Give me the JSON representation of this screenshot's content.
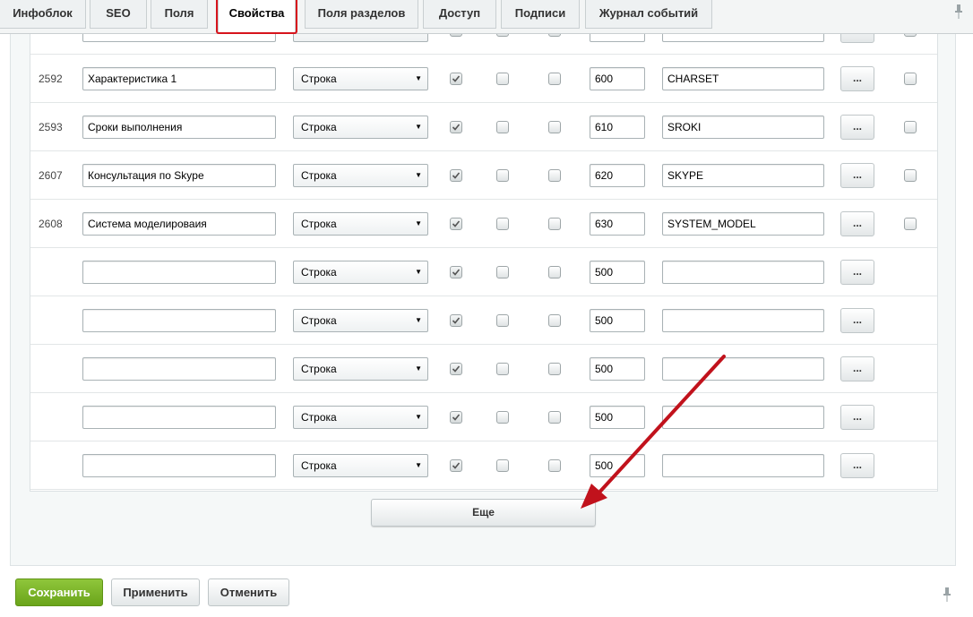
{
  "tabs": [
    {
      "label": "Инфоблок"
    },
    {
      "label": "SEO"
    },
    {
      "label": "Поля"
    },
    {
      "label": "Свойства"
    },
    {
      "label": "Поля разделов"
    },
    {
      "label": "Доступ"
    },
    {
      "label": "Подписи"
    },
    {
      "label": "Журнал событий"
    }
  ],
  "active_tab": "Свойства",
  "rows": [
    {
      "id": "",
      "name": "",
      "type": "",
      "sort": "",
      "code": "",
      "checks": [
        true,
        false,
        false
      ],
      "last_check": true
    },
    {
      "id": "2592",
      "name": "Характеристика 1",
      "type": "Строка",
      "sort": "600",
      "code": "CHARSET",
      "checks": [
        true,
        false,
        false
      ],
      "last_check": true
    },
    {
      "id": "2593",
      "name": "Сроки выполнения",
      "type": "Строка",
      "sort": "610",
      "code": "SROKI",
      "checks": [
        true,
        false,
        false
      ],
      "last_check": true
    },
    {
      "id": "2607",
      "name": "Консультация по Skype",
      "type": "Строка",
      "sort": "620",
      "code": "SKYPE",
      "checks": [
        true,
        false,
        false
      ],
      "last_check": true
    },
    {
      "id": "2608",
      "name": "Система моделироваия",
      "type": "Строка",
      "sort": "630",
      "code": "SYSTEM_MODEL",
      "checks": [
        true,
        false,
        false
      ],
      "last_check": true
    },
    {
      "id": "",
      "name": "",
      "type": "Строка",
      "sort": "500",
      "code": "",
      "checks": [
        true,
        false,
        false
      ],
      "last_check": false
    },
    {
      "id": "",
      "name": "",
      "type": "Строка",
      "sort": "500",
      "code": "",
      "checks": [
        true,
        false,
        false
      ],
      "last_check": false
    },
    {
      "id": "",
      "name": "",
      "type": "Строка",
      "sort": "500",
      "code": "",
      "checks": [
        true,
        false,
        false
      ],
      "last_check": false
    },
    {
      "id": "",
      "name": "",
      "type": "Строка",
      "sort": "500",
      "code": "",
      "checks": [
        true,
        false,
        false
      ],
      "last_check": false
    },
    {
      "id": "",
      "name": "",
      "type": "Строка",
      "sort": "500",
      "code": "",
      "checks": [
        true,
        false,
        false
      ],
      "last_check": false
    }
  ],
  "dots_label": "...",
  "more_label": "Еще",
  "footer": {
    "save_label": "Сохранить",
    "apply_label": "Применить",
    "cancel_label": "Отменить"
  },
  "colors": {
    "save_green": "#7ab52a",
    "highlight_red": "#d7141c",
    "annotation_arrow": "#c1121c"
  },
  "icons": [
    "pin-icon",
    "chevron-down-icon",
    "checkmark-icon",
    "annotation-arrow"
  ]
}
